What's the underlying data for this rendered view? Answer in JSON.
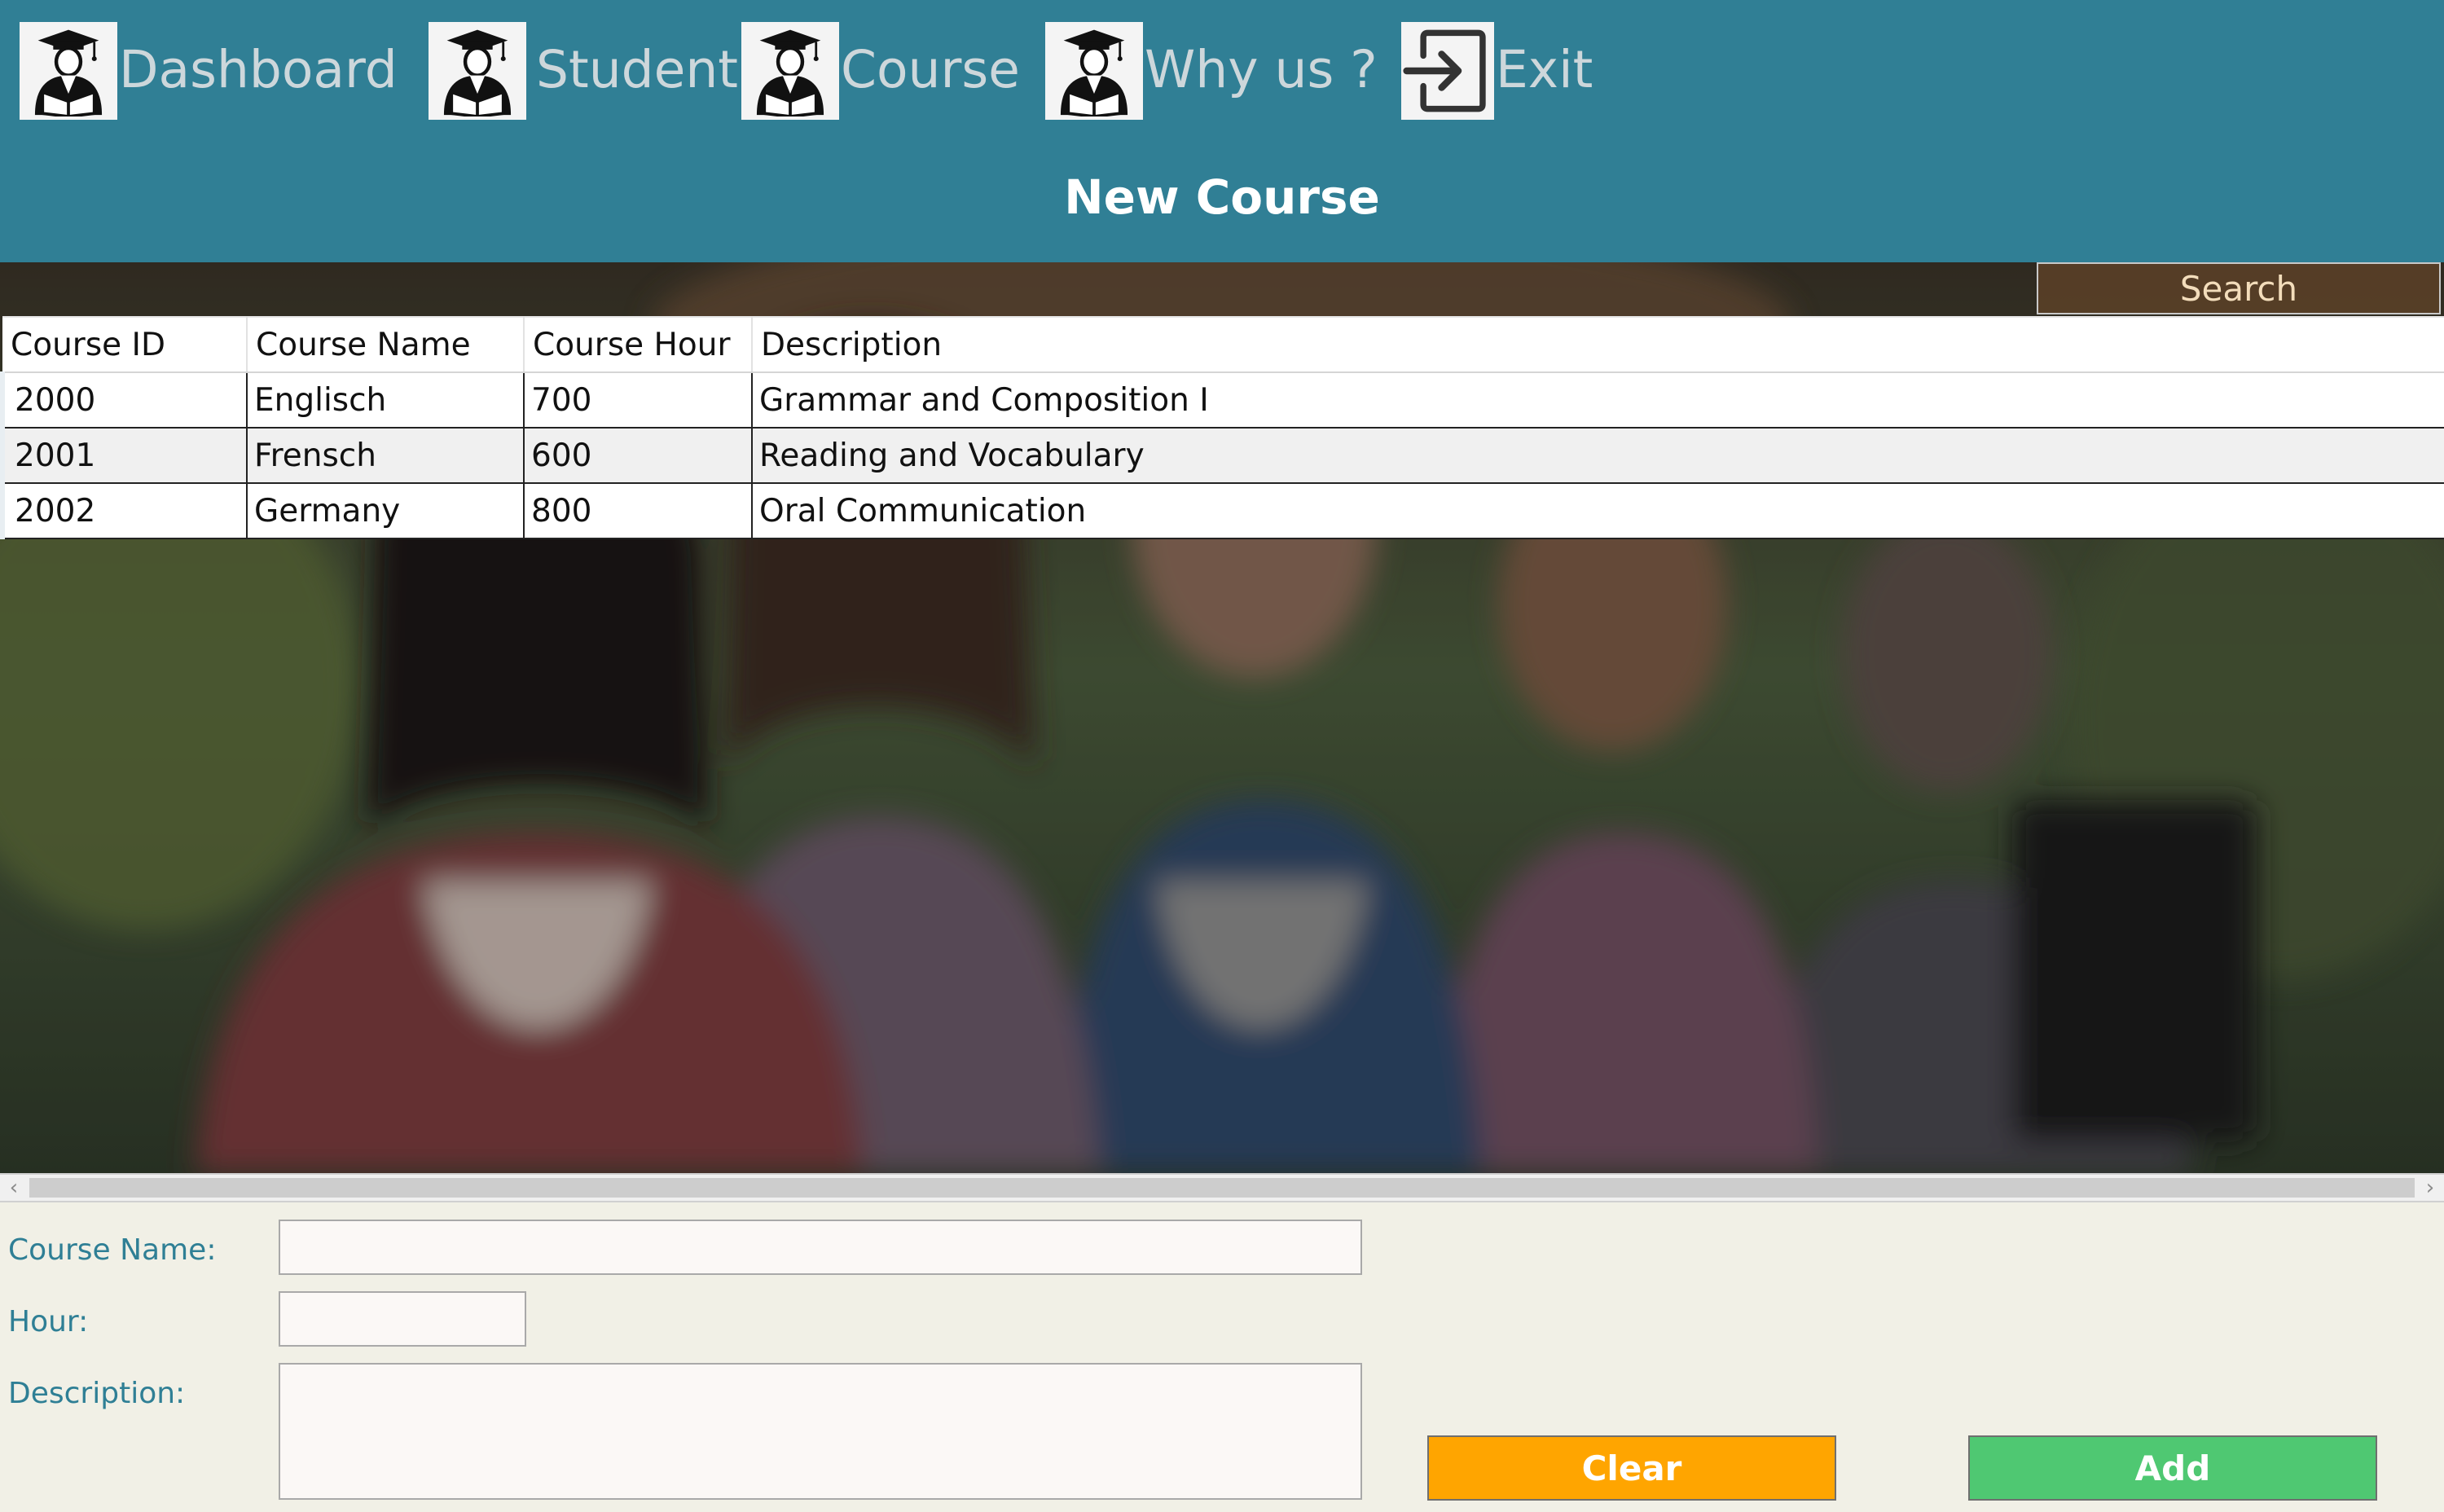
{
  "nav": {
    "items": [
      {
        "label": "Dashboard",
        "icon": "graduate-reading-icon"
      },
      {
        "label": "Student",
        "icon": "graduate-reading-icon"
      },
      {
        "label": "Course",
        "icon": "graduate-reading-icon"
      },
      {
        "label": "Why us ?",
        "icon": "graduate-reading-icon"
      },
      {
        "label": "Exit",
        "icon": "exit-icon"
      }
    ]
  },
  "page": {
    "title": "New Course"
  },
  "search": {
    "label": "Search"
  },
  "table": {
    "columns": [
      "Course ID",
      "Course Name",
      "Course Hour",
      "Description"
    ],
    "rows": [
      [
        "2000",
        "Englisch",
        "700",
        "Grammar and Composition I"
      ],
      [
        "2001",
        "Frensch",
        "600",
        "Reading and Vocabulary"
      ],
      [
        "2002",
        "Germany",
        "800",
        "Oral Communication"
      ]
    ]
  },
  "form": {
    "course_name_label": "Course Name:",
    "hour_label": "Hour:",
    "description_label": "Description:",
    "course_name_value": "",
    "hour_value": "",
    "description_value": ""
  },
  "buttons": {
    "clear": "Clear",
    "add": "Add"
  },
  "colors": {
    "header": "#307f95",
    "form_background": "#f1f0e6",
    "label": "#2f7f95",
    "clear_button": "#ffa500",
    "add_button": "#4fc872"
  }
}
